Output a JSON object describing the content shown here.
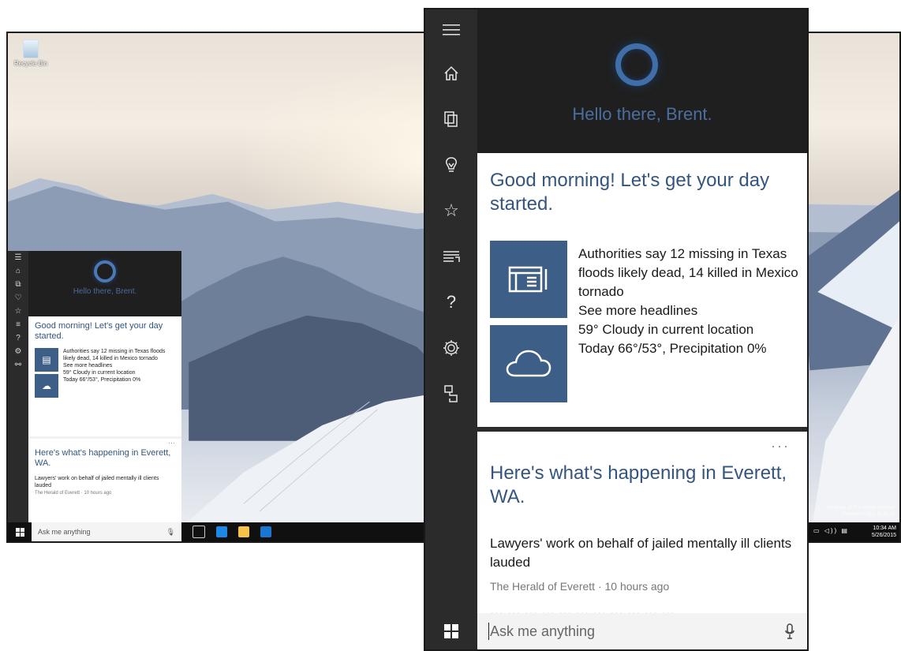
{
  "desktop": {
    "recycle_bin_label": "Recycle Bin",
    "watermark_line1": "Windows 10 Pro Insider Preview",
    "watermark_line2": "Evaluation copy. Build 10",
    "clock_time": "10:34 AM",
    "clock_date": "5/26/2015",
    "taskbar_search_placeholder": "Ask me anything"
  },
  "cortana": {
    "greeting": "Hello there, Brent.",
    "nav_icons": [
      "menu-icon",
      "home-icon",
      "notebook-icon",
      "lightbulb-icon",
      "star-icon",
      "news-icon",
      "help-icon",
      "settings-icon",
      "feedback-icon"
    ],
    "day_card": {
      "title": "Good morning! Let's get your day started.",
      "news_headline": "Authorities say 12 missing in Texas floods likely dead, 14 killed in Mexico tornado",
      "news_link": "See more headlines",
      "weather_current": "59° Cloudy in current location",
      "weather_today": "Today 66°/53°, Precipitation 0%"
    },
    "local_card": {
      "more_label": "···",
      "title": "Here's what's happening in Everett, WA.",
      "headline": "Lawyers' work on behalf of jailed mentally ill clients lauded",
      "source": "The Herald of Everett · 10 hours ago",
      "next_headline_partial": "··· ··· ··· ··· ··· ··· ··· ··· ··· ··· ···"
    },
    "search": {
      "placeholder": "Ask me anything"
    },
    "colors": {
      "accent": "#3f6ea8",
      "title_text": "#33557f",
      "tile": "#3d5e86",
      "rail": "#2b2b2b",
      "header": "#1f1f1f"
    }
  }
}
